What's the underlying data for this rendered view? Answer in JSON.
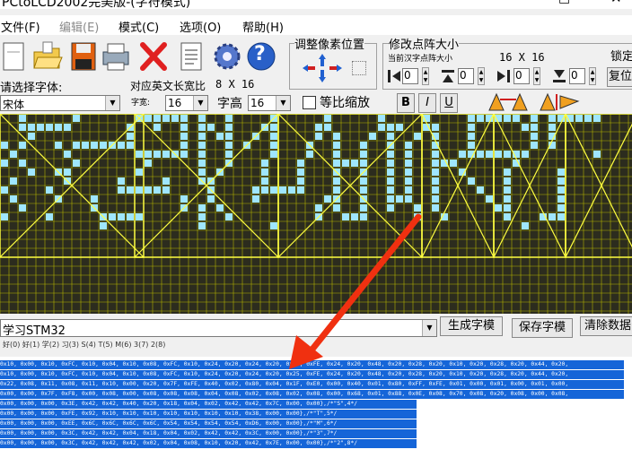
{
  "window": {
    "title": "PCtoLCD2002完美版-(字符模式)",
    "min_glyph": "□",
    "close_glyph": "✕"
  },
  "menu": [
    {
      "label": "文件(F)",
      "enabled": true
    },
    {
      "label": "编辑(E)",
      "enabled": false
    },
    {
      "label": "模式(C)",
      "enabled": true
    },
    {
      "label": "选项(O)",
      "enabled": true
    },
    {
      "label": "帮助(H)",
      "enabled": true
    }
  ],
  "toolbar": {
    "tool_icons": [
      "new-file-icon",
      "open-folder-icon",
      "save-disk-icon",
      "printer-icon",
      "delete-x-icon",
      "notepad-icon",
      "settings-gear-icon",
      "help-question-icon"
    ],
    "help_glyph": "?",
    "pixel_adjust_title": "调整像素位置",
    "dot_size_title": "修改点阵大小",
    "current_size_label": "当前汉字点阵大小",
    "current_size_value": "16  X  16",
    "lock_label": "锁定",
    "restore_label": "复位",
    "spin_values": [
      "0",
      "0",
      "0",
      "0"
    ]
  },
  "font_row": {
    "choose_font_label": "请选择字体:",
    "ratio_label": "对应英文长宽比",
    "ratio_value": "8 X 16",
    "font_name": "宋体",
    "width_label": "字宽:",
    "width_value": "16",
    "height_label": "字高",
    "height_value": "16",
    "proportional_label": "等比缩放",
    "bold_label": "B",
    "italic_label": "I",
    "underline_label": "U"
  },
  "canvas": {
    "bg": "#2c2c1e",
    "dot_on": "#9fe6ff",
    "grid": "#b5b500",
    "frame": "#ffff40"
  },
  "input": {
    "text": "学习STM32"
  },
  "buttons": {
    "generate": "生成字模",
    "save": "保存字模",
    "clear": "清除数据"
  },
  "char_row": "好(0) 好(1) 学(2) 习(3) S(4) T(5) M(6) 3(7) 2(8)",
  "output_lines": [
    "0x10, 0x00, 0x10, 0xFC, 0x10, 0x04, 0x10, 0x08, 0xFC, 0x10, 0x24, 0x20, 0x24, 0x20, 0x25, 0xFE, 0x24, 0x20, 0x48, 0x20, 0x28, 0x20, 0x10, 0x20, 0x28, 0x20, 0x44, 0x20,",
    "0x10, 0x00, 0x10, 0xFC, 0x10, 0x04, 0x10, 0x08, 0xFC, 0x10, 0x24, 0x20, 0x24, 0x20, 0x25, 0xFE, 0x24, 0x20, 0x48, 0x20, 0x28, 0x20, 0x10, 0x20, 0x28, 0x20, 0x44, 0x20,",
    "0x22, 0x08, 0x11, 0x08, 0x11, 0x10, 0x00, 0x20, 0x7F, 0xFE, 0x40, 0x02, 0x80, 0x04, 0x1F, 0xE0, 0x00, 0x40, 0x01, 0x80, 0xFF, 0xFE, 0x01, 0x00, 0x01, 0x00, 0x01, 0x00,",
    "0x00, 0x00, 0x7F, 0xF8, 0x00, 0x08, 0x00, 0x08, 0x08, 0x08, 0x04, 0x08, 0x02, 0x08, 0x02, 0x08, 0x00, 0x68, 0x01, 0x88, 0x0E, 0x08, 0x70, 0x08, 0x20, 0x08, 0x00, 0x08,",
    "0x00, 0x00, 0x00, 0x3E, 0x42, 0x42, 0x40, 0x20, 0x18, 0x04, 0x02, 0x42, 0x42, 0x7C, 0x00, 0x00},/*\"S\",4*/",
    "0x00, 0x00, 0x00, 0xFE, 0x92, 0x10, 0x10, 0x10, 0x10, 0x10, 0x10, 0x10, 0x38, 0x00, 0x00},/*\"T\",5*/",
    "0x00, 0x00, 0x00, 0xEE, 0x6C, 0x6C, 0x6C, 0x6C, 0x54, 0x54, 0x54, 0x54, 0xD6, 0x00, 0x00},/*\"M\",6*/",
    "0x00, 0x00, 0x00, 0x3C, 0x42, 0x42, 0x04, 0x18, 0x04, 0x02, 0x42, 0x42, 0x3C, 0x00, 0x00},/*\"3\",7*/",
    "0x00, 0x00, 0x00, 0x3C, 0x42, 0x42, 0x42, 0x02, 0x04, 0x08, 0x10, 0x20, 0x42, 0x7E, 0x00, 0x00},/*\"2\",8*/"
  ],
  "annotation": {
    "arrow_color": "#f03010"
  }
}
